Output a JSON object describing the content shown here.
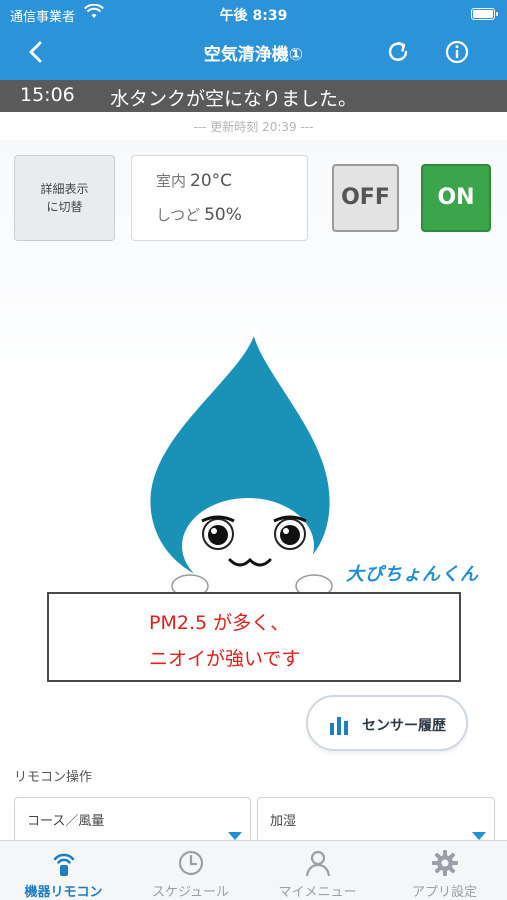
{
  "status_bar": {
    "carrier": "通信事業者",
    "time": "午後 8:39"
  },
  "nav": {
    "title": "空気清浄機①"
  },
  "notice": {
    "time": "15:06",
    "message": "水タンクが空になりました。"
  },
  "updated": "--- 更新時刻 20:39 ---",
  "detail_button": {
    "line1": "詳細表示",
    "line2": "に切替"
  },
  "sensors": {
    "room_label": "室内",
    "room_value": "20°C",
    "humidity_label": "しつど",
    "humidity_value": "50%"
  },
  "power": {
    "off_label": "OFF",
    "on_label": "ON"
  },
  "mascot_brand": "大ぴちょんくん",
  "message": {
    "line1": "PM2.5 が多く、",
    "line2": "ニオイが強いです"
  },
  "sensor_history_label": "センサー履歴",
  "remote": {
    "title": "リモコン操作",
    "dropdown1": "コース／風量",
    "dropdown2": "加湿"
  },
  "tabs": [
    {
      "label": "機器リモコン",
      "icon": "remote-icon",
      "active": true
    },
    {
      "label": "スケジュール",
      "icon": "clock-icon",
      "active": false
    },
    {
      "label": "マイメニュー",
      "icon": "person-icon",
      "active": false
    },
    {
      "label": "アプリ設定",
      "icon": "gear-icon",
      "active": false
    }
  ],
  "colors": {
    "header": "#2c93d8",
    "notice_bg": "#5a5a5a",
    "on_button": "#3aa54a",
    "message_text": "#e0201b",
    "accent": "#1f7ec2"
  }
}
